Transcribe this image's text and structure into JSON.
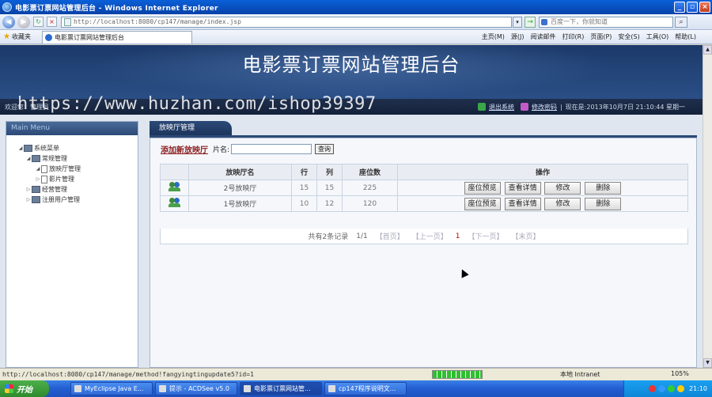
{
  "browser": {
    "window_title": "电影票订票网站管理后台 - Windows Internet Explorer",
    "address_url": "http://localhost:8080/cp147/manage/index.jsp",
    "search_placeholder": "百度一下，你就知道",
    "favorites_label": "收藏夹",
    "tab_title": "电影票订票网站管理后台",
    "commands": [
      "主页(M)",
      "源(J)",
      "阅读邮件",
      "打印(R)",
      "页面(P)",
      "安全(S)",
      "工具(O)",
      "帮助(L)"
    ],
    "status_url": "http://localhost:8080/cp147/manage/method!fangyingtingupdate5?id=1",
    "status_zone": "本地 Intranet",
    "zoom": "105%",
    "progress_fraction": 1.0
  },
  "site": {
    "title": "电影票订票网站管理后台",
    "welcome": "欢迎您：管理员",
    "logout": "退出系统",
    "change_password": "修改密码",
    "datetime": "现在是:2013年10月7日 21:10:44 星期一",
    "watermark": "https://www.huzhan.com/ishop39397"
  },
  "menu": {
    "title": "Main Menu",
    "root": "系统菜单",
    "items": [
      {
        "label": "常规管理",
        "children": [
          "放映厅管理",
          "影片管理"
        ]
      },
      {
        "label": "经营管理"
      },
      {
        "label": "注册用户管理"
      }
    ]
  },
  "main": {
    "tab": "放映厅管理",
    "add_link": "添加新放映厅",
    "name_label": "片名:",
    "query_button": "查询",
    "columns": [
      "放映厅名",
      "行",
      "列",
      "座位数",
      "操作"
    ],
    "rows": [
      {
        "name": "2号放映厅",
        "rows": "15",
        "cols": "15",
        "seats": "225"
      },
      {
        "name": "1号放映厅",
        "rows": "10",
        "cols": "12",
        "seats": "120"
      }
    ],
    "actions": {
      "preview": "座位预览",
      "detail": "查看详情",
      "edit": "修改",
      "delete": "删除"
    },
    "pager": {
      "total": "共有2条记录",
      "pages": "1/1",
      "first": "【首页】",
      "prev": "【上一页】",
      "current": "1",
      "next": "【下一页】",
      "last": "【末页】"
    }
  },
  "taskbar": {
    "start": "开始",
    "tasks": [
      "MyEclipse Java E...",
      "提示 - ACDSee v5.0",
      "电影票订票网站管...",
      "cp147程序说明文..."
    ],
    "clock": "21:10"
  }
}
